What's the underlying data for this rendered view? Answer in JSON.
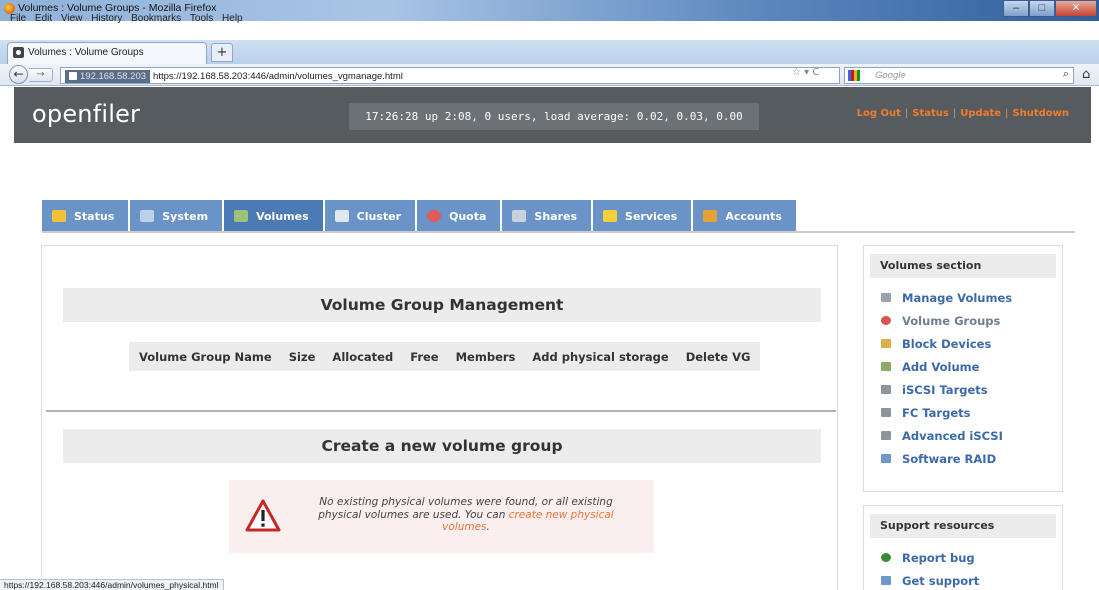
{
  "browser": {
    "window_title": "Volumes : Volume Groups - Mozilla Firefox",
    "menu": [
      "File",
      "Edit",
      "View",
      "History",
      "Bookmarks",
      "Tools",
      "Help"
    ],
    "tab_title": "Volumes : Volume Groups",
    "new_tab": "+",
    "site_identity": "192.168.58.203",
    "url": "https://192.168.58.203:446/admin/volumes_vgmanage.html",
    "search_placeholder": "Google",
    "status_url": "https://192.168.58.203:446/admin/volumes_physical.html"
  },
  "header": {
    "logo": "openfiler",
    "uptime": "17:26:28 up 2:08, 0 users, load average: 0.02, 0.03, 0.00",
    "links": [
      "Log Out",
      "Status",
      "Update",
      "Shutdown"
    ],
    "link_color": "#f17c2e"
  },
  "nav_tabs": [
    {
      "label": "Status",
      "icon": "status-icon",
      "color": "#f2c13a"
    },
    {
      "label": "System",
      "icon": "system-icon",
      "color": "#bcd0e8"
    },
    {
      "label": "Volumes",
      "icon": "volumes-icon",
      "color": "#9fc27a",
      "active": true
    },
    {
      "label": "Cluster",
      "icon": "cluster-icon",
      "color": "#dfe6ee"
    },
    {
      "label": "Quota",
      "icon": "quota-icon",
      "color": "#e05a5a"
    },
    {
      "label": "Shares",
      "icon": "shares-icon",
      "color": "#c9d2dc"
    },
    {
      "label": "Services",
      "icon": "services-icon",
      "color": "#f5d23b"
    },
    {
      "label": "Accounts",
      "icon": "accounts-icon",
      "color": "#e4a23a"
    }
  ],
  "main": {
    "vg_title": "Volume Group Management",
    "vg_columns": [
      "Volume Group Name",
      "Size",
      "Allocated",
      "Free",
      "Members",
      "Add physical storage",
      "Delete VG"
    ],
    "create_title": "Create a new volume group",
    "warning_text": "No existing physical volumes were found, or all existing physical volumes are used. You can",
    "warning_link": "create new physical volumes",
    "warning_end": "."
  },
  "sidebar": {
    "volumes_heading": "Volumes section",
    "volumes_items": [
      {
        "label": "Manage Volumes",
        "icon": "manage-volumes-icon",
        "color": "#9aa3ad"
      },
      {
        "label": "Volume Groups",
        "icon": "volume-groups-icon",
        "color": "#d9534f",
        "current": true
      },
      {
        "label": "Block Devices",
        "icon": "block-devices-icon",
        "color": "#d9b24a"
      },
      {
        "label": "Add Volume",
        "icon": "add-volume-icon",
        "color": "#8bab6a"
      },
      {
        "label": "iSCSI Targets",
        "icon": "iscsi-targets-icon",
        "color": "#8c949c"
      },
      {
        "label": "FC Targets",
        "icon": "fc-targets-icon",
        "color": "#8c949c"
      },
      {
        "label": "Advanced iSCSI",
        "icon": "advanced-iscsi-icon",
        "color": "#8c949c"
      },
      {
        "label": "Software RAID",
        "icon": "software-raid-icon",
        "color": "#6f98c9"
      }
    ],
    "support_heading": "Support resources",
    "support_items": [
      {
        "label": "Report bug",
        "icon": "report-bug-icon",
        "color": "#3a8a3a"
      },
      {
        "label": "Get support",
        "icon": "get-support-icon",
        "color": "#6f98c9"
      }
    ]
  }
}
